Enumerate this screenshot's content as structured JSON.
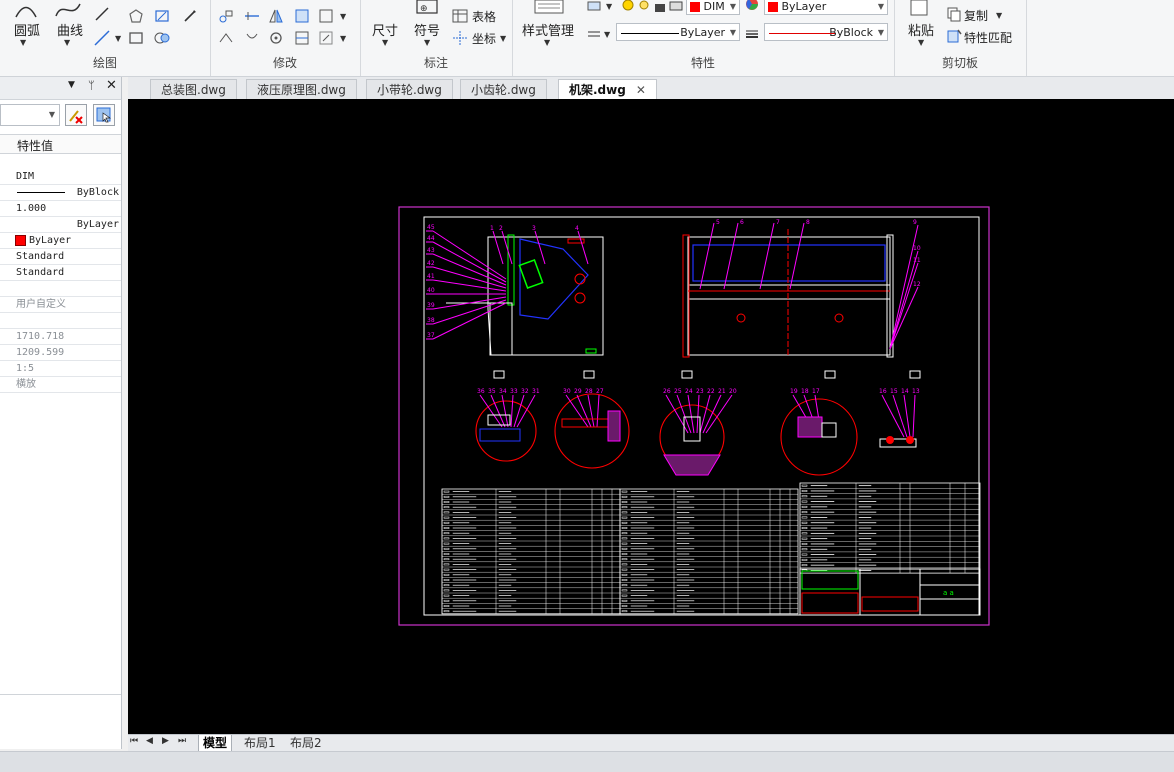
{
  "ribbon": {
    "draw": {
      "arc_label": "圆弧",
      "curve_label": "曲线",
      "title": "绘图"
    },
    "modify": {
      "title": "修改"
    },
    "annotate": {
      "dim_label": "尺寸",
      "symbol_label": "符号",
      "table_label": "表格",
      "coord_label": "坐标",
      "title": "标注"
    },
    "properties": {
      "style_mgr_label": "样式管理",
      "layer_value": "DIM",
      "color_value": "ByLayer",
      "linetype_value": "ByLayer",
      "lineweight_value": "ByBlock",
      "title": "特性"
    },
    "clipboard": {
      "paste_label": "粘贴",
      "copy_label": "复制",
      "match_label": "特性匹配",
      "title": "剪切板"
    }
  },
  "palette": {
    "column_header": "特性值",
    "rows": [
      {
        "value": "DIM"
      },
      {
        "value": "ByBlock",
        "kind": "line"
      },
      {
        "value": "1.000"
      },
      {
        "value": "ByLayer",
        "kind": "right"
      },
      {
        "value": "ByLayer",
        "kind": "swatch"
      },
      {
        "value": "Standard"
      },
      {
        "value": "Standard"
      },
      {
        "value": ""
      },
      {
        "value": "用户自定义",
        "kind": "grey"
      },
      {
        "value": ""
      },
      {
        "value": "1710.718",
        "kind": "grey"
      },
      {
        "value": "1209.599",
        "kind": "grey"
      },
      {
        "value": "1:5",
        "kind": "grey"
      },
      {
        "value": "横放",
        "kind": "grey"
      }
    ]
  },
  "doc_tabs": [
    {
      "label": "总装图.dwg"
    },
    {
      "label": "液压原理图.dwg"
    },
    {
      "label": "小带轮.dwg"
    },
    {
      "label": "小齿轮.dwg"
    },
    {
      "label": "机架.dwg",
      "active": true
    }
  ],
  "layout_tabs": [
    {
      "label": "模型",
      "active": true
    },
    {
      "label": "布局1"
    },
    {
      "label": "布局2"
    }
  ],
  "drawing": {
    "title_block_text": "a a"
  },
  "colors": {
    "ribbon_bg": "#f5f6f7",
    "canvas_bg": "#000000",
    "frame": "#cc33cc",
    "magenta": "#ff00ff",
    "blue": "#2233ff",
    "green": "#00ff00",
    "red": "#ff0000"
  }
}
